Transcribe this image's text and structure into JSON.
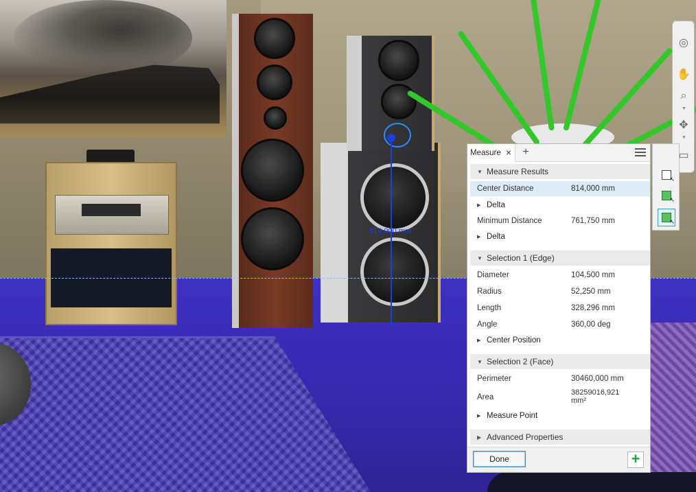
{
  "viewport": {
    "measure_label": "814,000 mm"
  },
  "navbar": {
    "items": [
      {
        "name": "steering-wheel-icon",
        "glyph": "◎"
      },
      {
        "name": "pan-hand-icon",
        "glyph": "✋"
      },
      {
        "name": "zoom-icon",
        "glyph": "⌕"
      },
      {
        "name": "orbit-icon",
        "glyph": "✥"
      },
      {
        "name": "view-face-icon",
        "glyph": "▭"
      }
    ]
  },
  "measure_panel": {
    "tab_label": "Measure",
    "tab_close": "×",
    "tab_add": "+",
    "results": {
      "header": "Measure Results",
      "center_distance_label": "Center Distance",
      "center_distance_value": "814,000 mm",
      "delta1_label": "Delta",
      "min_distance_label": "Minimum Distance",
      "min_distance_value": "761,750 mm",
      "delta2_label": "Delta"
    },
    "selection1": {
      "header": "Selection 1 (Edge)",
      "diameter_label": "Diameter",
      "diameter_value": "104,500 mm",
      "radius_label": "Radius",
      "radius_value": "52,250 mm",
      "length_label": "Length",
      "length_value": "328,296 mm",
      "angle_label": "Angle",
      "angle_value": "360,00 deg",
      "center_position_label": "Center Position"
    },
    "selection2": {
      "header": "Selection 2 (Face)",
      "perimeter_label": "Perimeter",
      "perimeter_value": "30460,000 mm",
      "area_label": "Area",
      "area_value_line1": "38259016,921",
      "area_value_line2": "mm²",
      "measure_point_label": "Measure Point"
    },
    "advanced_label": "Advanced Properties",
    "done_label": "Done",
    "add_label": "+"
  },
  "colors": {
    "accent": "#3a8fd0",
    "highlight_row": "#dcecf7",
    "add_green": "#22a33a",
    "measure_blue": "#1a3fe0"
  }
}
